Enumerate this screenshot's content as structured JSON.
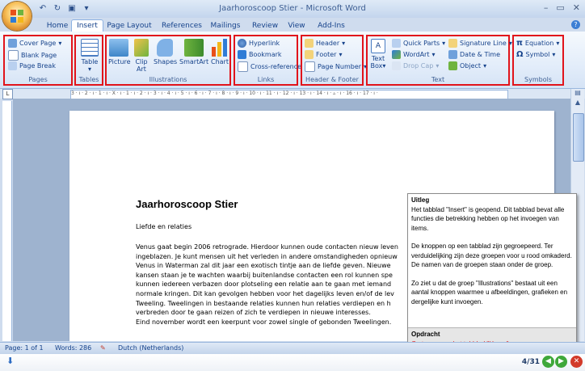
{
  "window": {
    "title": "Jaarhoroscoop Stier - Microsoft Word"
  },
  "tabs": [
    "Home",
    "Insert",
    "Page Layout",
    "References",
    "Mailings",
    "Review",
    "View",
    "Add-Ins"
  ],
  "ribbon": {
    "pages": {
      "label": "Pages",
      "items": [
        "Cover Page",
        "Blank Page",
        "Page Break"
      ]
    },
    "tables": {
      "label": "Tables",
      "item": "Table"
    },
    "illustrations": {
      "label": "Illustrations",
      "items": [
        "Picture",
        "Clip Art",
        "Shapes",
        "SmartArt",
        "Chart"
      ]
    },
    "links": {
      "label": "Links",
      "items": [
        "Hyperlink",
        "Bookmark",
        "Cross-reference"
      ]
    },
    "header_footer": {
      "label": "Header & Footer",
      "items": [
        "Header",
        "Footer",
        "Page Number"
      ]
    },
    "text": {
      "label": "Text",
      "items": [
        "Text Box",
        "Quick Parts",
        "WordArt",
        "Drop Cap",
        "Signature Line",
        "Date & Time",
        "Object"
      ]
    },
    "symbols": {
      "label": "Symbols",
      "items": [
        "Equation",
        "Symbol"
      ]
    }
  },
  "ruler": {
    "text": "3 · ı · 2 · ı · 1 · ı · X · ı · 1 · ı · 2 · ı · 3 · ı · 4 · ı · 5 · ı · 6 · ı · 7 · ı · 8 · ı · 9 · ı · 10 · ı · 11 · ı · 12 · ı · 13 · ı · 14 · ı · ▵ · ı · 16 · ı · 17 · ı ·"
  },
  "document": {
    "title": "Jaarhoroscoop Stier",
    "subtitle": "Liefde en relaties",
    "lines": [
      "Venus gaat begin 2006 retrograde. Hierdoor kunnen oude contacten nieuw leven",
      "ingeblazen. Je kunt mensen uit het verleden in andere omstandigheden opnieuw",
      "Venus in Waterman zal dit jaar een exotisch tintje aan de liefde geven. Nieuwe",
      "kansen staan je te wachten waarbij buitenlandse contacten een rol kunnen spe",
      "kunnen iedereen verbazen door plotseling een relatie aan te gaan met iemand",
      "normale kringen. Dit kan gevolgen hebben voor het dagelijks leven en/of de lev",
      "Tweeling. Tweelingen in bestaande relaties kunnen hun relaties verdiepen en h",
      "verbreden door te gaan reizen of zich te verdiepen in nieuwe interesses.",
      "Eind november wordt een keerpunt voor zowel single of gebonden Tweelingen."
    ]
  },
  "tooltip": {
    "heading": "Uitleg",
    "paragraphs": [
      "Het tabblad \"Insert\" is geopend. Dit tabblad bevat alle functies die betrekking hebben op het invoegen van items.",
      "De knoppen op een tabblad zijn gegroepeerd. Ter verduidelijking zijn deze groepen voor u rood omkaderd. De namen van de groepen staan onder de groep.",
      "Zo ziet u dat de groep \"Illustrations\" bestaat uit een aantal knoppen waarmee u afbeeldingen, grafieken en dergelijke kunt invoegen."
    ],
    "task_heading": "Opdracht",
    "task": "Ga terug naar het tabblad \"Home\"."
  },
  "status": {
    "page": "Page: 1 of 1",
    "words": "Words: 286",
    "language": "Dutch (Netherlands)"
  },
  "navigation": {
    "counter": "4/31"
  },
  "colors": {
    "highlight": "#e1141b",
    "ribbon": "#dfeaf7",
    "accent": "#15428b"
  }
}
